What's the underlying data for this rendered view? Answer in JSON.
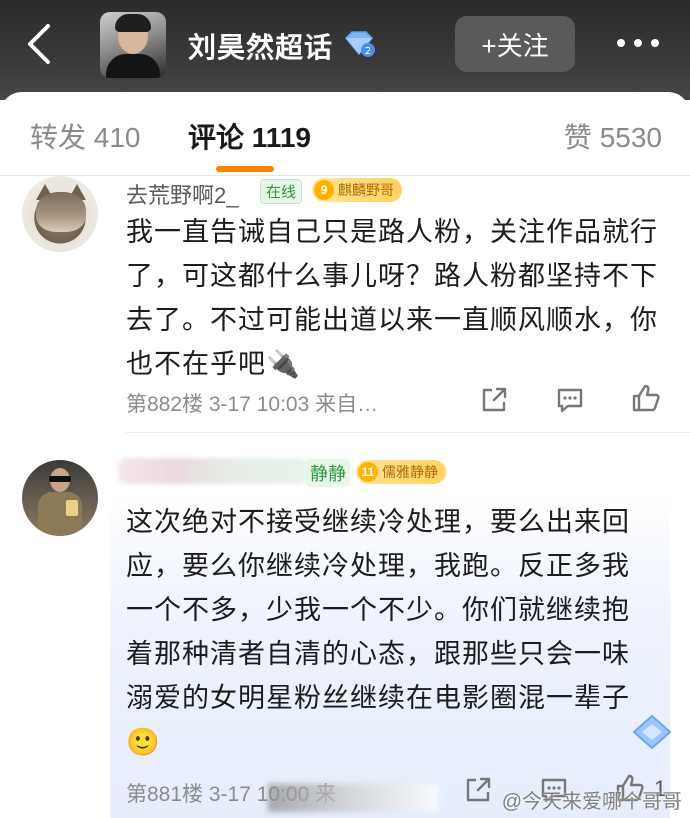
{
  "header": {
    "title": "刘昊然超话",
    "follow_label": "+关注",
    "level_badge": "2"
  },
  "tabs": {
    "repost": "转发 410",
    "comment": "评论 1119",
    "like": "赞 5530"
  },
  "comments": [
    {
      "name": "去荒野啊2_",
      "online": "在线",
      "fan_level": "9",
      "fan_title": "麒麟野哥",
      "text": "我一直告诫自己只是路人粉，关注作品就行了，可这都什么事儿呀？路人粉都坚持不下去了。不过可能出道以来一直顺风顺水，你也不在乎吧🔌",
      "meta": "第882楼  3-17 10:03  来自…"
    },
    {
      "name_tail": "静静",
      "fan_level": "11",
      "fan_title": "儒雅静静",
      "text": "这次绝对不接受继续冷处理，要么出来回应，要么你继续冷处理，我跑。反正多我一个不多，少我一个不少。你们就继续抱着那种清者自清的心态，跟那些只会一味溺爱的女明星粉丝继续在电影圈混一辈子🙂",
      "meta": "第881楼  3-17  10:00  来",
      "like_count": "1"
    }
  ],
  "watermark": "@今天来爱哪个哥哥",
  "colors": {
    "accent": "#ff8200",
    "header_bg": "#3a3a3a",
    "online_green": "#2f9a3b",
    "fan_badge": "#ffd260"
  },
  "icons": [
    "back-arrow-icon",
    "level-diamond-icon",
    "more-dots-icon",
    "share-icon",
    "comment-icon",
    "like-icon",
    "diamond-sticker-icon"
  ]
}
